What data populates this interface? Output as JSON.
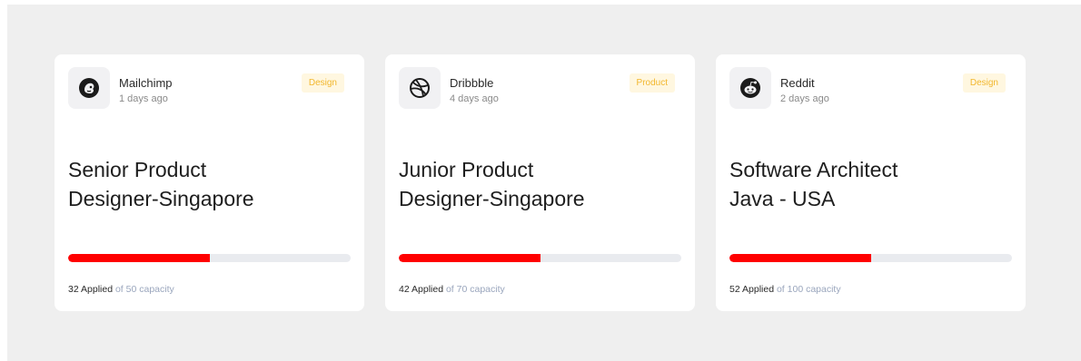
{
  "jobs": [
    {
      "company": "Mailchimp",
      "posted": "1 days ago",
      "tag": "Design",
      "title_line1": "Senior Product",
      "title_line2": "Designer-Singapore",
      "applied": "32 Applied",
      "capacity": "of 50 capacity",
      "progress": 0.5,
      "icon": "mailchimp-logo-icon"
    },
    {
      "company": "Dribbble",
      "posted": "4 days ago",
      "tag": "Product",
      "title_line1": "Junior Product",
      "title_line2": "Designer-Singapore",
      "applied": "42 Applied",
      "capacity": "of 70 capacity",
      "progress": 0.5,
      "icon": "dribbble-logo-icon"
    },
    {
      "company": "Reddit",
      "posted": "2 days ago",
      "tag": "Design",
      "title_line1": "Software Architect",
      "title_line2": "Java - USA",
      "applied": "52 Applied",
      "capacity": "of 100 capacity",
      "progress": 0.5,
      "icon": "reddit-logo-icon"
    }
  ],
  "colors": {
    "progress_fill": "#ff0000",
    "progress_track": "#e9ebef",
    "tag_text": "#f2b72d",
    "tag_bg": "#fff7e0"
  }
}
